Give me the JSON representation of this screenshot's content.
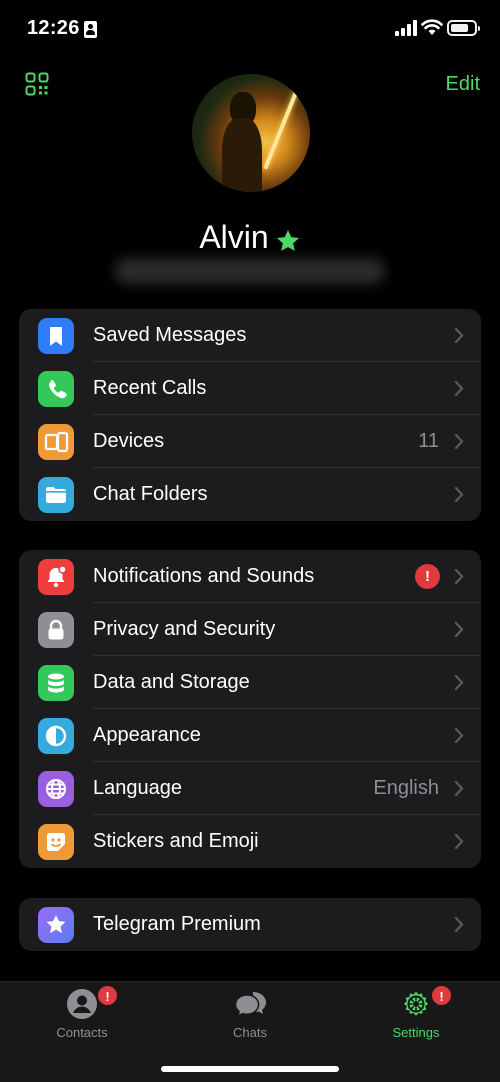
{
  "status_bar": {
    "time": "12:26"
  },
  "header": {
    "edit_label": "Edit"
  },
  "profile": {
    "name": "Alvin"
  },
  "groups": [
    {
      "items": [
        {
          "label": "Saved Messages",
          "icon": "bookmark-icon",
          "color": "#2f7cf6"
        },
        {
          "label": "Recent Calls",
          "icon": "phone-icon",
          "color": "#34c759"
        },
        {
          "label": "Devices",
          "icon": "devices-icon",
          "color": "#f09a37",
          "value": "11"
        },
        {
          "label": "Chat Folders",
          "icon": "folder-icon",
          "color": "#35aadc"
        }
      ]
    },
    {
      "items": [
        {
          "label": "Notifications and Sounds",
          "icon": "bell-icon",
          "color": "#ee3e3c",
          "badge": "!"
        },
        {
          "label": "Privacy and Security",
          "icon": "lock-icon",
          "color": "#8e8e93"
        },
        {
          "label": "Data and Storage",
          "icon": "database-icon",
          "color": "#34c759"
        },
        {
          "label": "Appearance",
          "icon": "appearance-icon",
          "color": "#35aadc"
        },
        {
          "label": "Language",
          "icon": "globe-icon",
          "color": "#9a5ee0",
          "value": "English"
        },
        {
          "label": "Stickers and Emoji",
          "icon": "sticker-icon",
          "color": "#f09a37"
        }
      ]
    },
    {
      "items": [
        {
          "label": "Telegram Premium",
          "icon": "premium-star-icon",
          "color": "#7b6cf0"
        }
      ]
    }
  ],
  "tabs": [
    {
      "label": "Contacts",
      "icon": "person-icon",
      "badge": "!"
    },
    {
      "label": "Chats",
      "icon": "chat-bubbles-icon"
    },
    {
      "label": "Settings",
      "icon": "settings-gear-icon",
      "badge": "!",
      "active": true
    }
  ],
  "colors": {
    "accent": "#4cd964",
    "background": "#000000",
    "cell": "#1c1c1e",
    "alert": "#e0393e"
  }
}
